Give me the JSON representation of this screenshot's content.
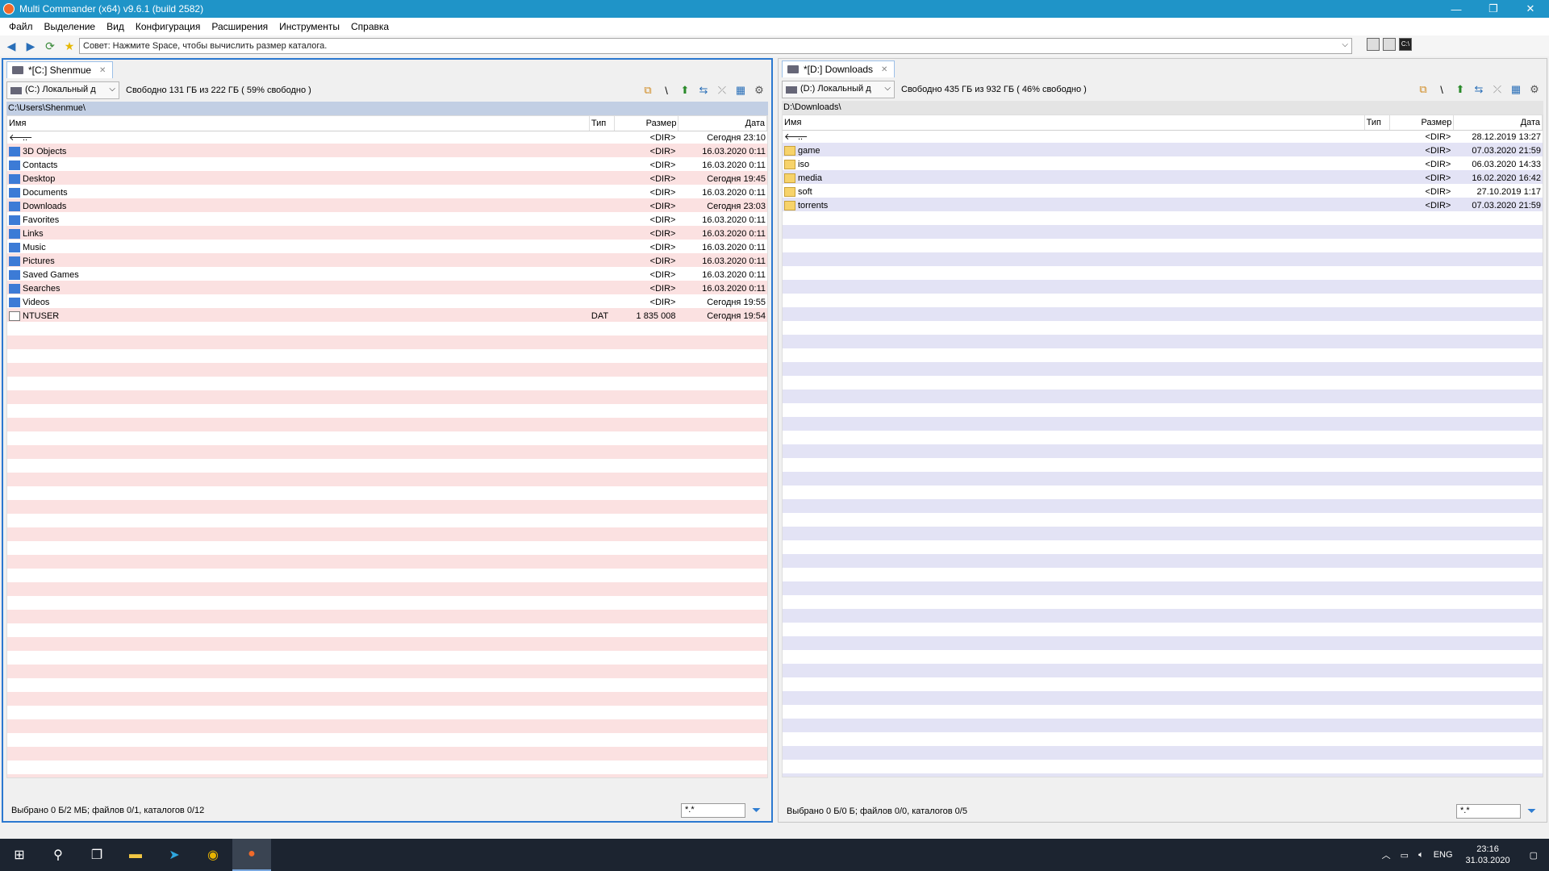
{
  "window": {
    "title": "Multi Commander (x64)  v9.6.1 (build 2582)",
    "controls": {
      "minimize": "—",
      "restore": "❐",
      "close": "✕"
    }
  },
  "menu": [
    "Файл",
    "Выделение",
    "Вид",
    "Конфигурация",
    "Расширения",
    "Инструменты",
    "Справка"
  ],
  "toolbar": {
    "tip": "Совет: Нажмите Space, чтобы вычислить размер каталога."
  },
  "left_panel": {
    "tab": "*[C:] Shenmue",
    "drive": "(C:) Локальный д",
    "free": "Свободно 131 ГБ из 222 ГБ ( 59% свободно )",
    "path": "C:\\Users\\Shenmue\\",
    "columns": {
      "name": "Имя",
      "type": "Тип",
      "size": "Размер",
      "date": "Дата"
    },
    "rows": [
      {
        "name": "..",
        "type": "",
        "size": "<DIR>",
        "date": "Сегодня 23:10",
        "icon": "up"
      },
      {
        "name": "3D Objects",
        "type": "",
        "size": "<DIR>",
        "date": "16.03.2020 0:11",
        "icon": "sys"
      },
      {
        "name": "Contacts",
        "type": "",
        "size": "<DIR>",
        "date": "16.03.2020 0:11",
        "icon": "sys"
      },
      {
        "name": "Desktop",
        "type": "",
        "size": "<DIR>",
        "date": "Сегодня 19:45",
        "icon": "sys"
      },
      {
        "name": "Documents",
        "type": "",
        "size": "<DIR>",
        "date": "16.03.2020 0:11",
        "icon": "sys"
      },
      {
        "name": "Downloads",
        "type": "",
        "size": "<DIR>",
        "date": "Сегодня 23:03",
        "icon": "sys"
      },
      {
        "name": "Favorites",
        "type": "",
        "size": "<DIR>",
        "date": "16.03.2020 0:11",
        "icon": "sys"
      },
      {
        "name": "Links",
        "type": "",
        "size": "<DIR>",
        "date": "16.03.2020 0:11",
        "icon": "sys"
      },
      {
        "name": "Music",
        "type": "",
        "size": "<DIR>",
        "date": "16.03.2020 0:11",
        "icon": "sys"
      },
      {
        "name": "Pictures",
        "type": "",
        "size": "<DIR>",
        "date": "16.03.2020 0:11",
        "icon": "sys"
      },
      {
        "name": "Saved Games",
        "type": "",
        "size": "<DIR>",
        "date": "16.03.2020 0:11",
        "icon": "sys"
      },
      {
        "name": "Searches",
        "type": "",
        "size": "<DIR>",
        "date": "16.03.2020 0:11",
        "icon": "sys"
      },
      {
        "name": "Videos",
        "type": "",
        "size": "<DIR>",
        "date": "Сегодня 19:55",
        "icon": "sys"
      },
      {
        "name": "NTUSER",
        "type": "DAT",
        "size": "1 835 008",
        "date": "Сегодня 19:54",
        "icon": "file"
      }
    ],
    "status": "Выбрано 0 Б/2 МБ; файлов 0/1, каталогов 0/12",
    "filter": "*.*"
  },
  "right_panel": {
    "tab": "*[D:] Downloads",
    "drive": "(D:) Локальный д",
    "free": "Свободно 435 ГБ из 932 ГБ ( 46% свободно )",
    "path": "D:\\Downloads\\",
    "columns": {
      "name": "Имя",
      "type": "Тип",
      "size": "Размер",
      "date": "Дата"
    },
    "rows": [
      {
        "name": "..",
        "type": "",
        "size": "<DIR>",
        "date": "28.12.2019 13:27",
        "icon": "up"
      },
      {
        "name": "game",
        "type": "",
        "size": "<DIR>",
        "date": "07.03.2020 21:59",
        "icon": "folder"
      },
      {
        "name": "iso",
        "type": "",
        "size": "<DIR>",
        "date": "06.03.2020 14:33",
        "icon": "folder"
      },
      {
        "name": "media",
        "type": "",
        "size": "<DIR>",
        "date": "16.02.2020 16:42",
        "icon": "folder"
      },
      {
        "name": "soft",
        "type": "",
        "size": "<DIR>",
        "date": "27.10.2019 1:17",
        "icon": "folder"
      },
      {
        "name": "torrents",
        "type": "",
        "size": "<DIR>",
        "date": "07.03.2020 21:59",
        "icon": "folder"
      }
    ],
    "status": "Выбрано 0 Б/0 Б; файлов 0/0, каталогов 0/5",
    "filter": "*.*"
  },
  "taskbar": {
    "lang": "ENG",
    "time": "23:16",
    "date": "31.03.2020"
  },
  "colors": {
    "titlebar": "#1f94c8",
    "left_stripe": "#fbe1e1",
    "right_stripe": "#e3e3f5",
    "path_bar": "#c2cfe4"
  }
}
